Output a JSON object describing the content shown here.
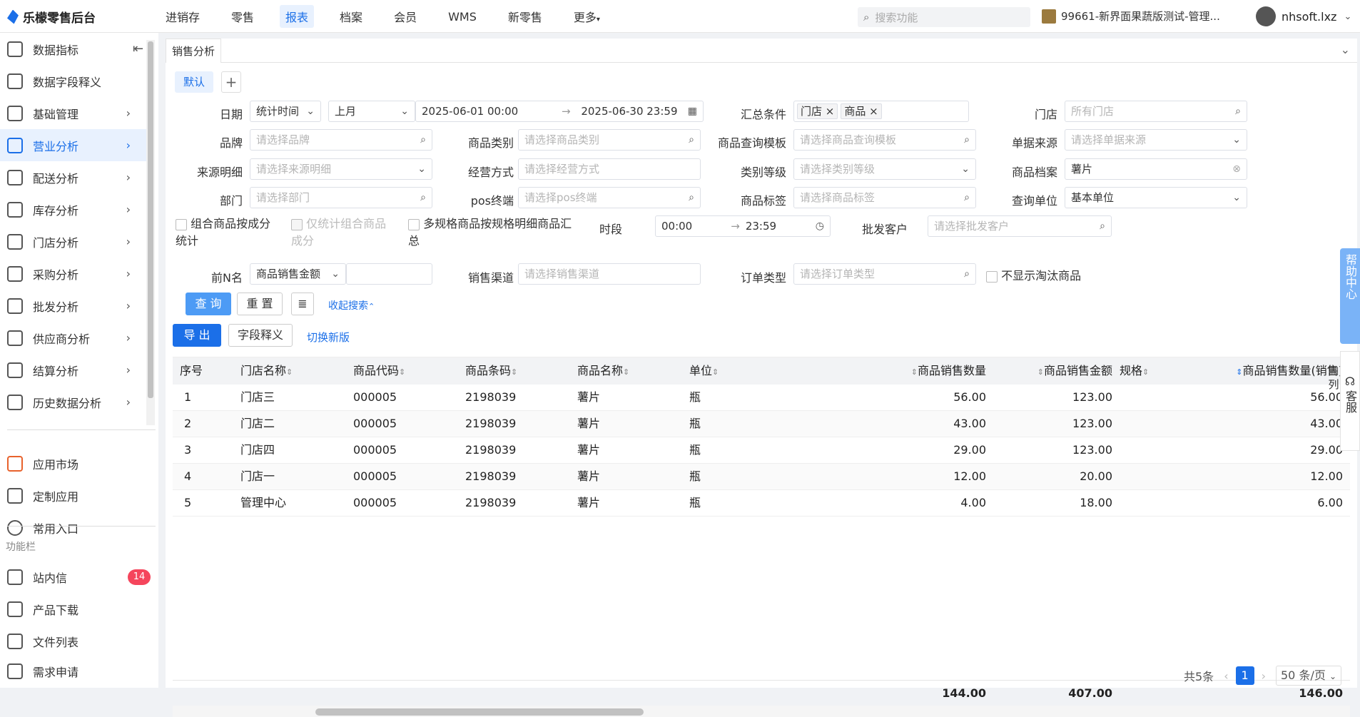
{
  "app": {
    "title": "乐檬零售后台"
  },
  "top_nav": [
    "进销存",
    "零售",
    "报表",
    "档案",
    "会员",
    "WMS",
    "新零售",
    "更多"
  ],
  "top_nav_active": 2,
  "search": {
    "placeholder": "搜索功能"
  },
  "store": "99661-新界面果蔬版测试-管理...",
  "user": "nhsoft.lxz",
  "sidebar": {
    "items": [
      {
        "label": "数据指标",
        "icon": "home-icon"
      },
      {
        "label": "数据字段释义",
        "icon": "book-icon"
      },
      {
        "label": "基础管理",
        "icon": "grid-icon"
      },
      {
        "label": "营业分析",
        "icon": "store-icon"
      },
      {
        "label": "配送分析",
        "icon": "truck-icon"
      },
      {
        "label": "库存分析",
        "icon": "box-icon"
      },
      {
        "label": "门店分析",
        "icon": "shop-icon"
      },
      {
        "label": "采购分析",
        "icon": "cart-icon"
      },
      {
        "label": "批发分析",
        "icon": "wholesale-icon"
      },
      {
        "label": "供应商分析",
        "icon": "person-icon"
      },
      {
        "label": "结算分析",
        "icon": "money-icon"
      },
      {
        "label": "历史数据分析",
        "icon": "chart-icon"
      }
    ],
    "active_index": 3,
    "apps": [
      {
        "label": "应用市场",
        "icon": "app-market-icon"
      },
      {
        "label": "定制应用",
        "icon": "cube-icon"
      },
      {
        "label": "常用入口",
        "icon": "heart-icon"
      }
    ],
    "func_label": "功能栏",
    "func": [
      {
        "label": "站内信",
        "icon": "mail-icon",
        "badge": "14"
      },
      {
        "label": "产品下载",
        "icon": "download-icon"
      },
      {
        "label": "文件列表",
        "icon": "list-icon"
      },
      {
        "label": "需求申请",
        "icon": "request-icon"
      }
    ]
  },
  "tab": "销售分析",
  "preset": "默认",
  "form": {
    "date_label": "日期",
    "date_type": "统计时间",
    "date_range": "上月",
    "date_start": "2025-06-01 00:00",
    "date_end": "2025-06-30 23:59",
    "summary_label": "汇总条件",
    "summary_tags": [
      "门店",
      "商品"
    ],
    "store_label": "门店",
    "store_ph": "所有门店",
    "brand_label": "品牌",
    "brand_ph": "请选择品牌",
    "category_label": "商品类别",
    "category_ph": "请选择商品类别",
    "template_label": "商品查询模板",
    "template_ph": "请选择商品查询模板",
    "source_label": "单据来源",
    "source_ph": "请选择单据来源",
    "source_detail_label": "来源明细",
    "source_detail_ph": "请选择来源明细",
    "biz_label": "经营方式",
    "biz_ph": "请选择经营方式",
    "level_label": "类别等级",
    "level_ph": "请选择类别等级",
    "item_label": "商品档案",
    "item_value": "薯片",
    "dept_label": "部门",
    "dept_ph": "请选择部门",
    "pos_label": "pos终端",
    "pos_ph": "请选择pos终端",
    "tag_label": "商品标签",
    "tag_ph": "请选择商品标签",
    "unit_label": "查询单位",
    "unit_value": "基本单位",
    "chk1": "组合商品按成分统计",
    "chk2": "仅统计组合商品成分",
    "chk3": "多规格商品按规格明细商品汇总",
    "period_label": "时段",
    "period_start": "00:00",
    "period_end": "23:59",
    "wholesale_label": "批发客户",
    "wholesale_ph": "请选择批发客户",
    "topn_label": "前N名",
    "topn_value": "商品销售金额",
    "channel_label": "销售渠道",
    "channel_ph": "请选择销售渠道",
    "order_label": "订单类型",
    "order_ph": "请选择订单类型",
    "hide_label": "不显示淘汰商品"
  },
  "buttons": {
    "query": "查 询",
    "reset": "重 置",
    "collapse": "收起搜索",
    "export": "导 出",
    "field_def": "字段释义",
    "switch": "切换新版"
  },
  "table": {
    "headers": [
      "序号",
      "门店名称",
      "商品代码",
      "商品条码",
      "商品名称",
      "单位",
      "商品销售数量",
      "商品销售金额",
      "规格",
      "商品销售数量(销售)"
    ],
    "rows": [
      [
        "1",
        "门店三",
        "000005",
        "2198039",
        "薯片",
        "瓶",
        "56.00",
        "123.00",
        "",
        "56.00"
      ],
      [
        "2",
        "门店二",
        "000005",
        "2198039",
        "薯片",
        "瓶",
        "43.00",
        "123.00",
        "",
        "43.00"
      ],
      [
        "3",
        "门店四",
        "000005",
        "2198039",
        "薯片",
        "瓶",
        "29.00",
        "123.00",
        "",
        "29.00"
      ],
      [
        "4",
        "门店一",
        "000005",
        "2198039",
        "薯片",
        "瓶",
        "12.00",
        "20.00",
        "",
        "12.00"
      ],
      [
        "5",
        "管理中心",
        "000005",
        "2198039",
        "薯片",
        "瓶",
        "4.00",
        "18.00",
        "",
        "6.00"
      ]
    ],
    "totals": {
      "qty": "144.00",
      "amount": "407.00",
      "qty_sales": "146.00"
    }
  },
  "pager": {
    "total": "共5条",
    "page": "1",
    "size": "50 条/页"
  },
  "help": "帮助中心",
  "service": "客服",
  "column_btn": "列"
}
